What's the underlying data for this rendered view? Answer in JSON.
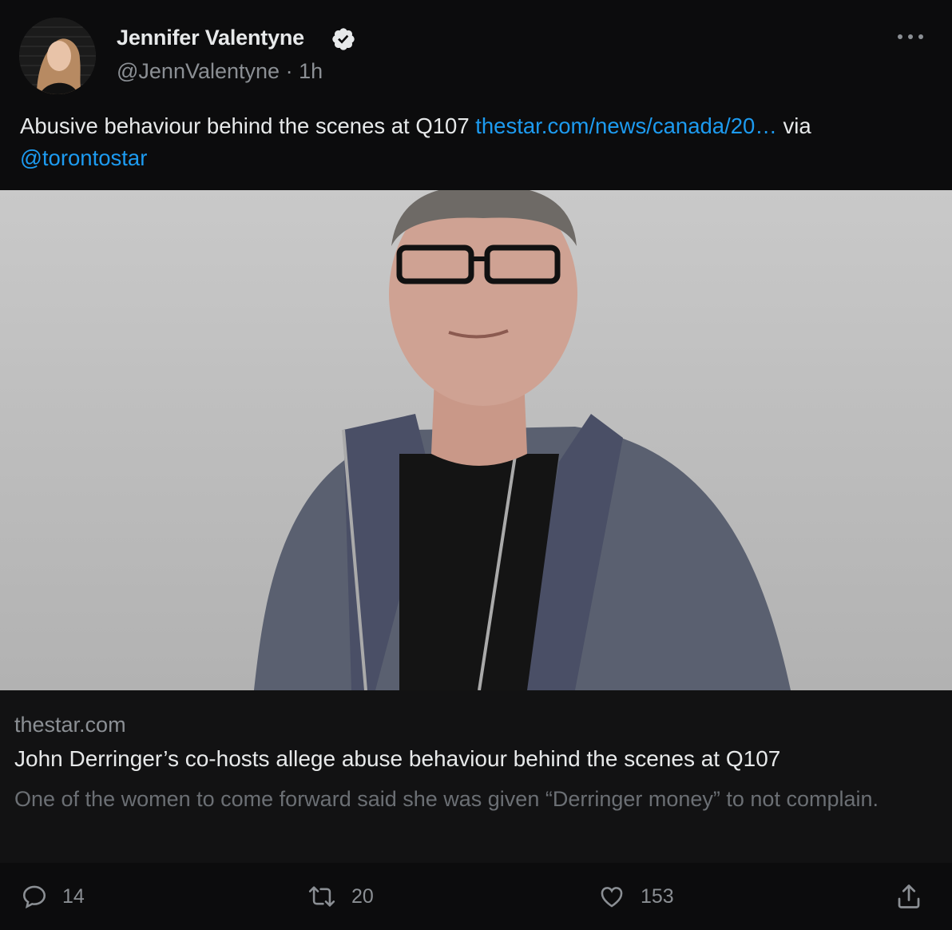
{
  "author": {
    "display_name": "Jennifer Valentyne",
    "handle": "@JennValentyne",
    "separator": "·",
    "time": "1h",
    "verified": true
  },
  "tweet": {
    "text": "Abusive behaviour behind the scenes at Q107 ",
    "link_text": "thestar.com/news/canada/20…",
    "after_link": " via",
    "mention": "@torontostar"
  },
  "card": {
    "domain": "thestar.com",
    "title": "John Derringer’s co-hosts allege abuse behaviour behind the scenes at Q107",
    "description": "One of the women to come forward said she was given “Derringer money” to not complain."
  },
  "actions": {
    "replies": "14",
    "retweets": "20",
    "likes": "153"
  },
  "colors": {
    "background": "#0c0c0d",
    "accent": "#1d9bf0",
    "muted": "#8b8f94",
    "text": "#e7e9ea"
  },
  "icons": [
    "more-icon",
    "verified-badge-icon",
    "reply-icon",
    "retweet-icon",
    "like-icon",
    "share-icon"
  ]
}
